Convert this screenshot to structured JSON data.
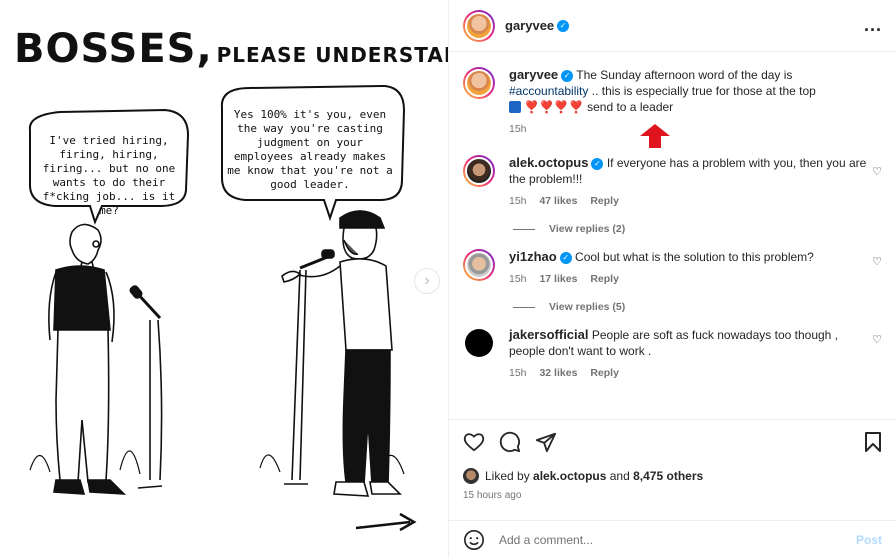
{
  "post_image": {
    "title_big": "BOSSES,",
    "title_small": "PLEASE UNDERSTAND THIS",
    "bubble_left": "I've tried hiring, firing, hiring, firing... but no one wants to do their f*cking job... is it me?",
    "bubble_right": "Yes 100% it's you, even the way you're casting judgment on your employees already makes me know that you're not a good leader.",
    "next_icon": "chevron-right-icon"
  },
  "header": {
    "username": "garyvee",
    "verified": true,
    "more_icon": "more-horizontal-icon",
    "more_label": "..."
  },
  "caption": {
    "username": "garyvee",
    "text_before": "The Sunday afternoon word of the day is",
    "hashtag": "#accountability",
    "text_after": ".. this is especially true for those at the top",
    "emoji_line": "❣️❣️❣️❣️",
    "emoji_suffix": "send to a leader",
    "time": "15h"
  },
  "comments": [
    {
      "username": "alek.octopus",
      "verified": true,
      "text": "If everyone has a problem with you, then you are the problem!!!",
      "time": "15h",
      "likes": "47 likes",
      "reply": "Reply",
      "view_replies": "View replies (2)"
    },
    {
      "username": "yi1zhao",
      "verified": true,
      "text": "Cool but what is the solution to this problem?",
      "time": "15h",
      "likes": "17 likes",
      "reply": "Reply",
      "view_replies": "View replies (5)"
    },
    {
      "username": "jakersofficial",
      "verified": false,
      "text": "People are soft as fuck nowadays too though , people don't want to work .",
      "time": "15h",
      "likes": "32 likes",
      "reply": "Reply"
    }
  ],
  "likes": {
    "prefix": "Liked by",
    "user": "alek.octopus",
    "joiner": "and",
    "others": "8,475 others"
  },
  "time_ago": "15 hours ago",
  "add_comment": {
    "placeholder": "Add a comment...",
    "post_label": "Post"
  },
  "colors": {
    "link": "#00376b",
    "verified": "#0095f6",
    "post_disabled": "#b3dbff",
    "annotation_arrow": "#e0141e"
  }
}
